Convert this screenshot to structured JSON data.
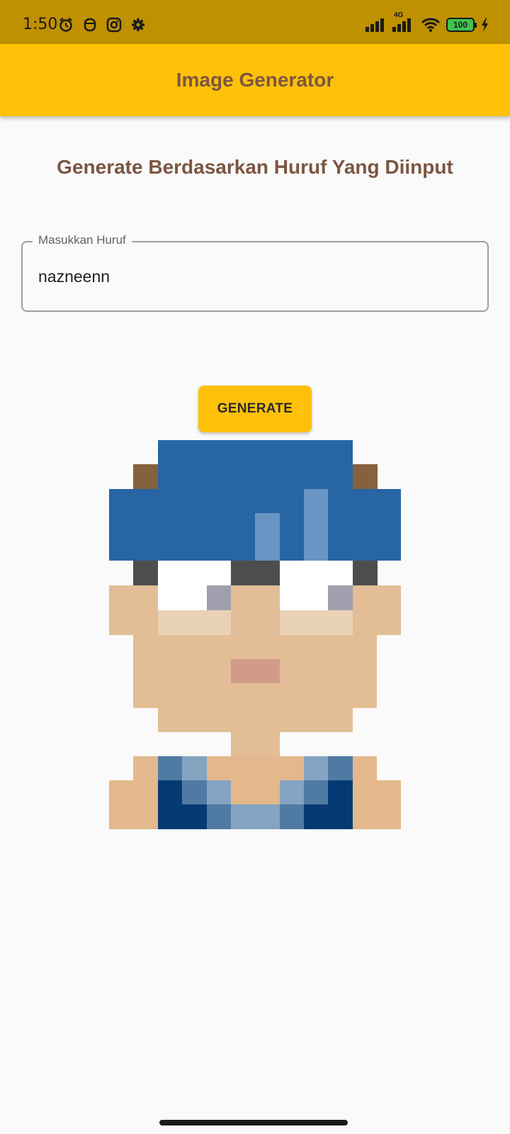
{
  "status_bar": {
    "time": "1:50",
    "network": "4G",
    "battery": "100"
  },
  "app_bar": {
    "title": "Image Generator"
  },
  "main": {
    "heading": "Generate Berdasarkan Huruf Yang Diinput",
    "input": {
      "label": "Masukkan Huruf",
      "value": "nazneenn"
    },
    "generate_button": "GENERATE"
  },
  "colors": {
    "accent": "#ffc107",
    "title_text": "#7b5643"
  },
  "icons": [
    "alarm-icon",
    "face-icon",
    "instagram-icon",
    "settings-icon",
    "signal-icon",
    "wifi-icon",
    "battery-icon",
    "charging-icon"
  ]
}
